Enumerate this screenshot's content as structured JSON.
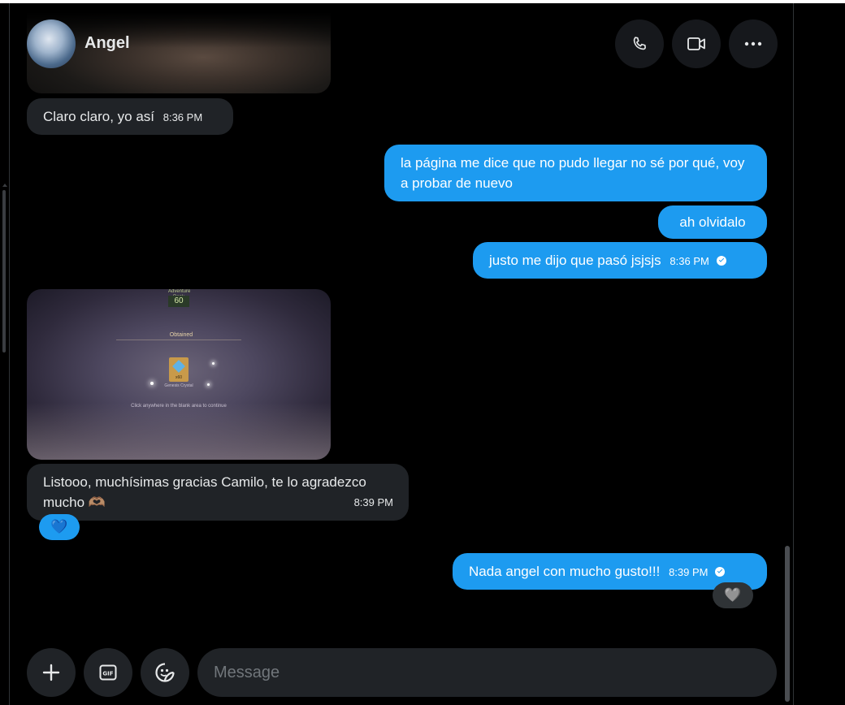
{
  "header": {
    "contact_name": "Angel"
  },
  "messages": [
    {
      "direction": "incoming",
      "text": "Claro claro, yo así",
      "time": "8:36 PM"
    },
    {
      "direction": "outgoing",
      "text": "la página me dice que no pudo llegar no sé por qué, voy a probar de nuevo"
    },
    {
      "direction": "outgoing",
      "text": "ah olvidalo"
    },
    {
      "direction": "outgoing",
      "text": "justo me dijo que pasó jsjsjs",
      "time": "8:36 PM"
    },
    {
      "direction": "incoming",
      "text": "Listooo, muchísimas gracias Camilo, te lo agradezco mucho 🫶🏽",
      "time": "8:39 PM",
      "reaction": "💙"
    },
    {
      "direction": "outgoing",
      "text": "Nada angel con mucho gusto!!!",
      "time": "8:39 PM",
      "reaction": "🩶"
    }
  ],
  "game_screenshot": {
    "rank_label": "Adventure Rank",
    "rank_value": "60",
    "obtained_label": "Obtained",
    "item_name": "Genesis Crystal",
    "item_count": "x60",
    "hint": "Click anywhere in the blank area to continue"
  },
  "composer": {
    "placeholder": "Message"
  },
  "colors": {
    "accent": "#1d9bf0",
    "incoming_bubble": "#202327",
    "background": "#000000"
  },
  "icons": [
    "phone-icon",
    "video-icon",
    "more-icon",
    "plus-icon",
    "gif-icon",
    "sticker-icon"
  ]
}
